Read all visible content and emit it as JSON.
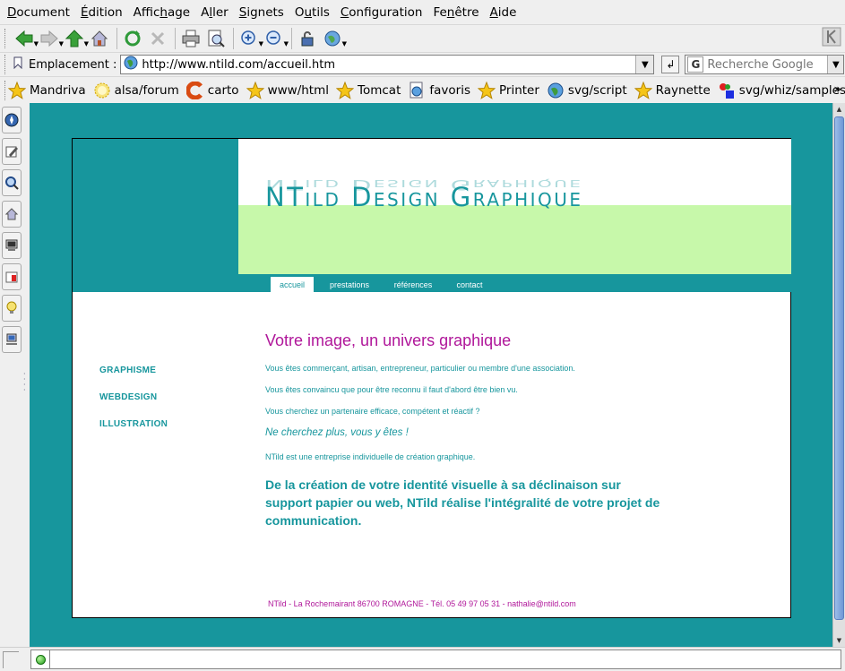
{
  "menu": [
    {
      "pre": "",
      "u": "D",
      "post": "ocument"
    },
    {
      "pre": "",
      "u": "É",
      "post": "dition"
    },
    {
      "pre": "Affic",
      "u": "h",
      "post": "age"
    },
    {
      "pre": "A",
      "u": "l",
      "post": "ler"
    },
    {
      "pre": "",
      "u": "S",
      "post": "ignets"
    },
    {
      "pre": "O",
      "u": "u",
      "post": "tils"
    },
    {
      "pre": "",
      "u": "C",
      "post": "onfiguration"
    },
    {
      "pre": "Fe",
      "u": "n",
      "post": "être"
    },
    {
      "pre": "",
      "u": "A",
      "post": "ide"
    }
  ],
  "location": {
    "label": "Emplacement :",
    "url": "http://www.ntild.com/accueil.htm",
    "search_placeholder": "Recherche Google"
  },
  "bookmarks": [
    {
      "label": "Mandriva",
      "icon": "star-icon"
    },
    {
      "label": "alsa/forum",
      "icon": "sun-icon"
    },
    {
      "label": "carto",
      "icon": "c-logo-icon"
    },
    {
      "label": "www/html",
      "icon": "star-icon"
    },
    {
      "label": "Tomcat",
      "icon": "star-icon"
    },
    {
      "label": "favoris",
      "icon": "page-globe-icon"
    },
    {
      "label": "Printer",
      "icon": "star-icon"
    },
    {
      "label": "svg/script",
      "icon": "globe-icon"
    },
    {
      "label": "Raynette",
      "icon": "star-icon"
    },
    {
      "label": "svg/whiz/samples",
      "icon": "shapes-icon"
    }
  ],
  "page": {
    "logo": "NTild Design Graphique",
    "nav": [
      "accueil",
      "prestations",
      "références",
      "contact"
    ],
    "sidenav": [
      "GRAPHISME",
      "WEBDESIGN",
      "ILLUSTRATION"
    ],
    "title": "Votre image, un univers graphique",
    "paragraphs": [
      "Vous êtes commerçant, artisan, entrepreneur, particulier ou membre d'une association.",
      "Vous êtes convaincu que pour être reconnu il faut d'abord être bien vu.",
      "Vous cherchez un partenaire efficace, compétent et réactif ?"
    ],
    "tagline": "Ne cherchez plus, vous y êtes !",
    "intro": "NTild est une entreprise individuelle de création graphique.",
    "highlight": "De la création de votre identité visuelle à sa déclinaison sur support papier ou web, NTild réalise l'intégralité de votre projet de communication.",
    "footer": "NTild - La Rochemairant 86700 ROMAGNE - Tél. 05 49 97 05 31 - nathalie@ntild.com"
  },
  "colors": {
    "teal": "#17969d",
    "magenta": "#b0179a",
    "green": "#c7f8aa"
  }
}
